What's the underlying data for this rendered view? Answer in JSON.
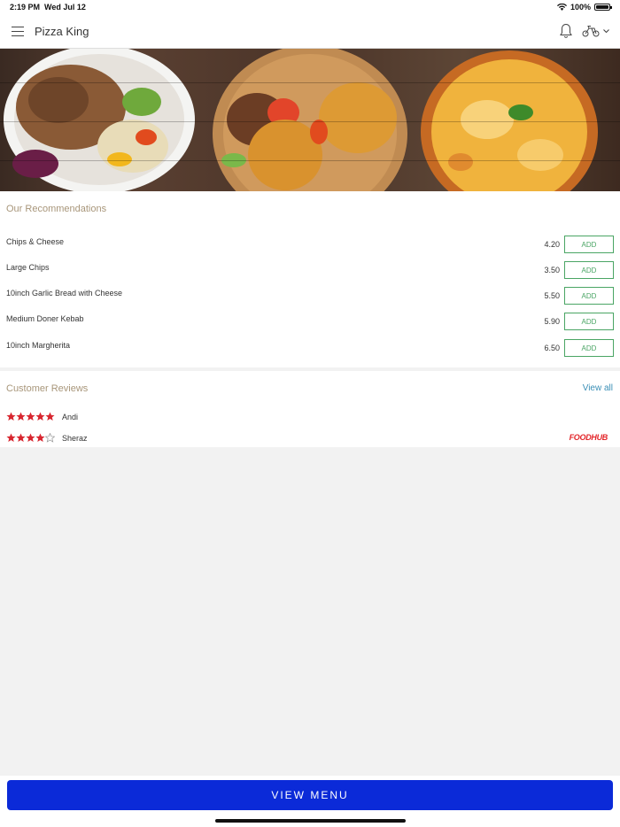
{
  "status_bar": {
    "time": "2:19 PM",
    "date": "Wed Jul 12",
    "battery": "100%"
  },
  "header": {
    "title": "Pizza King",
    "icons": [
      "menu-icon",
      "bell-icon",
      "delivery-scooter-icon",
      "chevron-down-icon"
    ]
  },
  "hero": {
    "description": "food-banner-image"
  },
  "recommendations": {
    "title": "Our Recommendations",
    "add_label": "ADD",
    "items": [
      {
        "name": "Chips & Cheese",
        "price": "4.20"
      },
      {
        "name": "Large Chips",
        "price": "3.50"
      },
      {
        "name": "10inch Garlic Bread with Cheese",
        "price": "5.50"
      },
      {
        "name": "Medium Doner Kebab",
        "price": "5.90"
      },
      {
        "name": "10inch Margherita",
        "price": "6.50"
      }
    ]
  },
  "reviews": {
    "title": "Customer Reviews",
    "view_all": "View all",
    "items": [
      {
        "name": "Andi",
        "rating": 5
      },
      {
        "name": "Sheraz",
        "rating": 4
      }
    ],
    "source_logo": "FOODHUB"
  },
  "footer": {
    "view_menu": "VIEW MENU"
  },
  "colors": {
    "accent_green": "#4aa564",
    "primary_blue": "#0b2ad8",
    "star_red": "#d8262f",
    "section_title": "#a8967a",
    "link_blue": "#3a8fb6"
  }
}
